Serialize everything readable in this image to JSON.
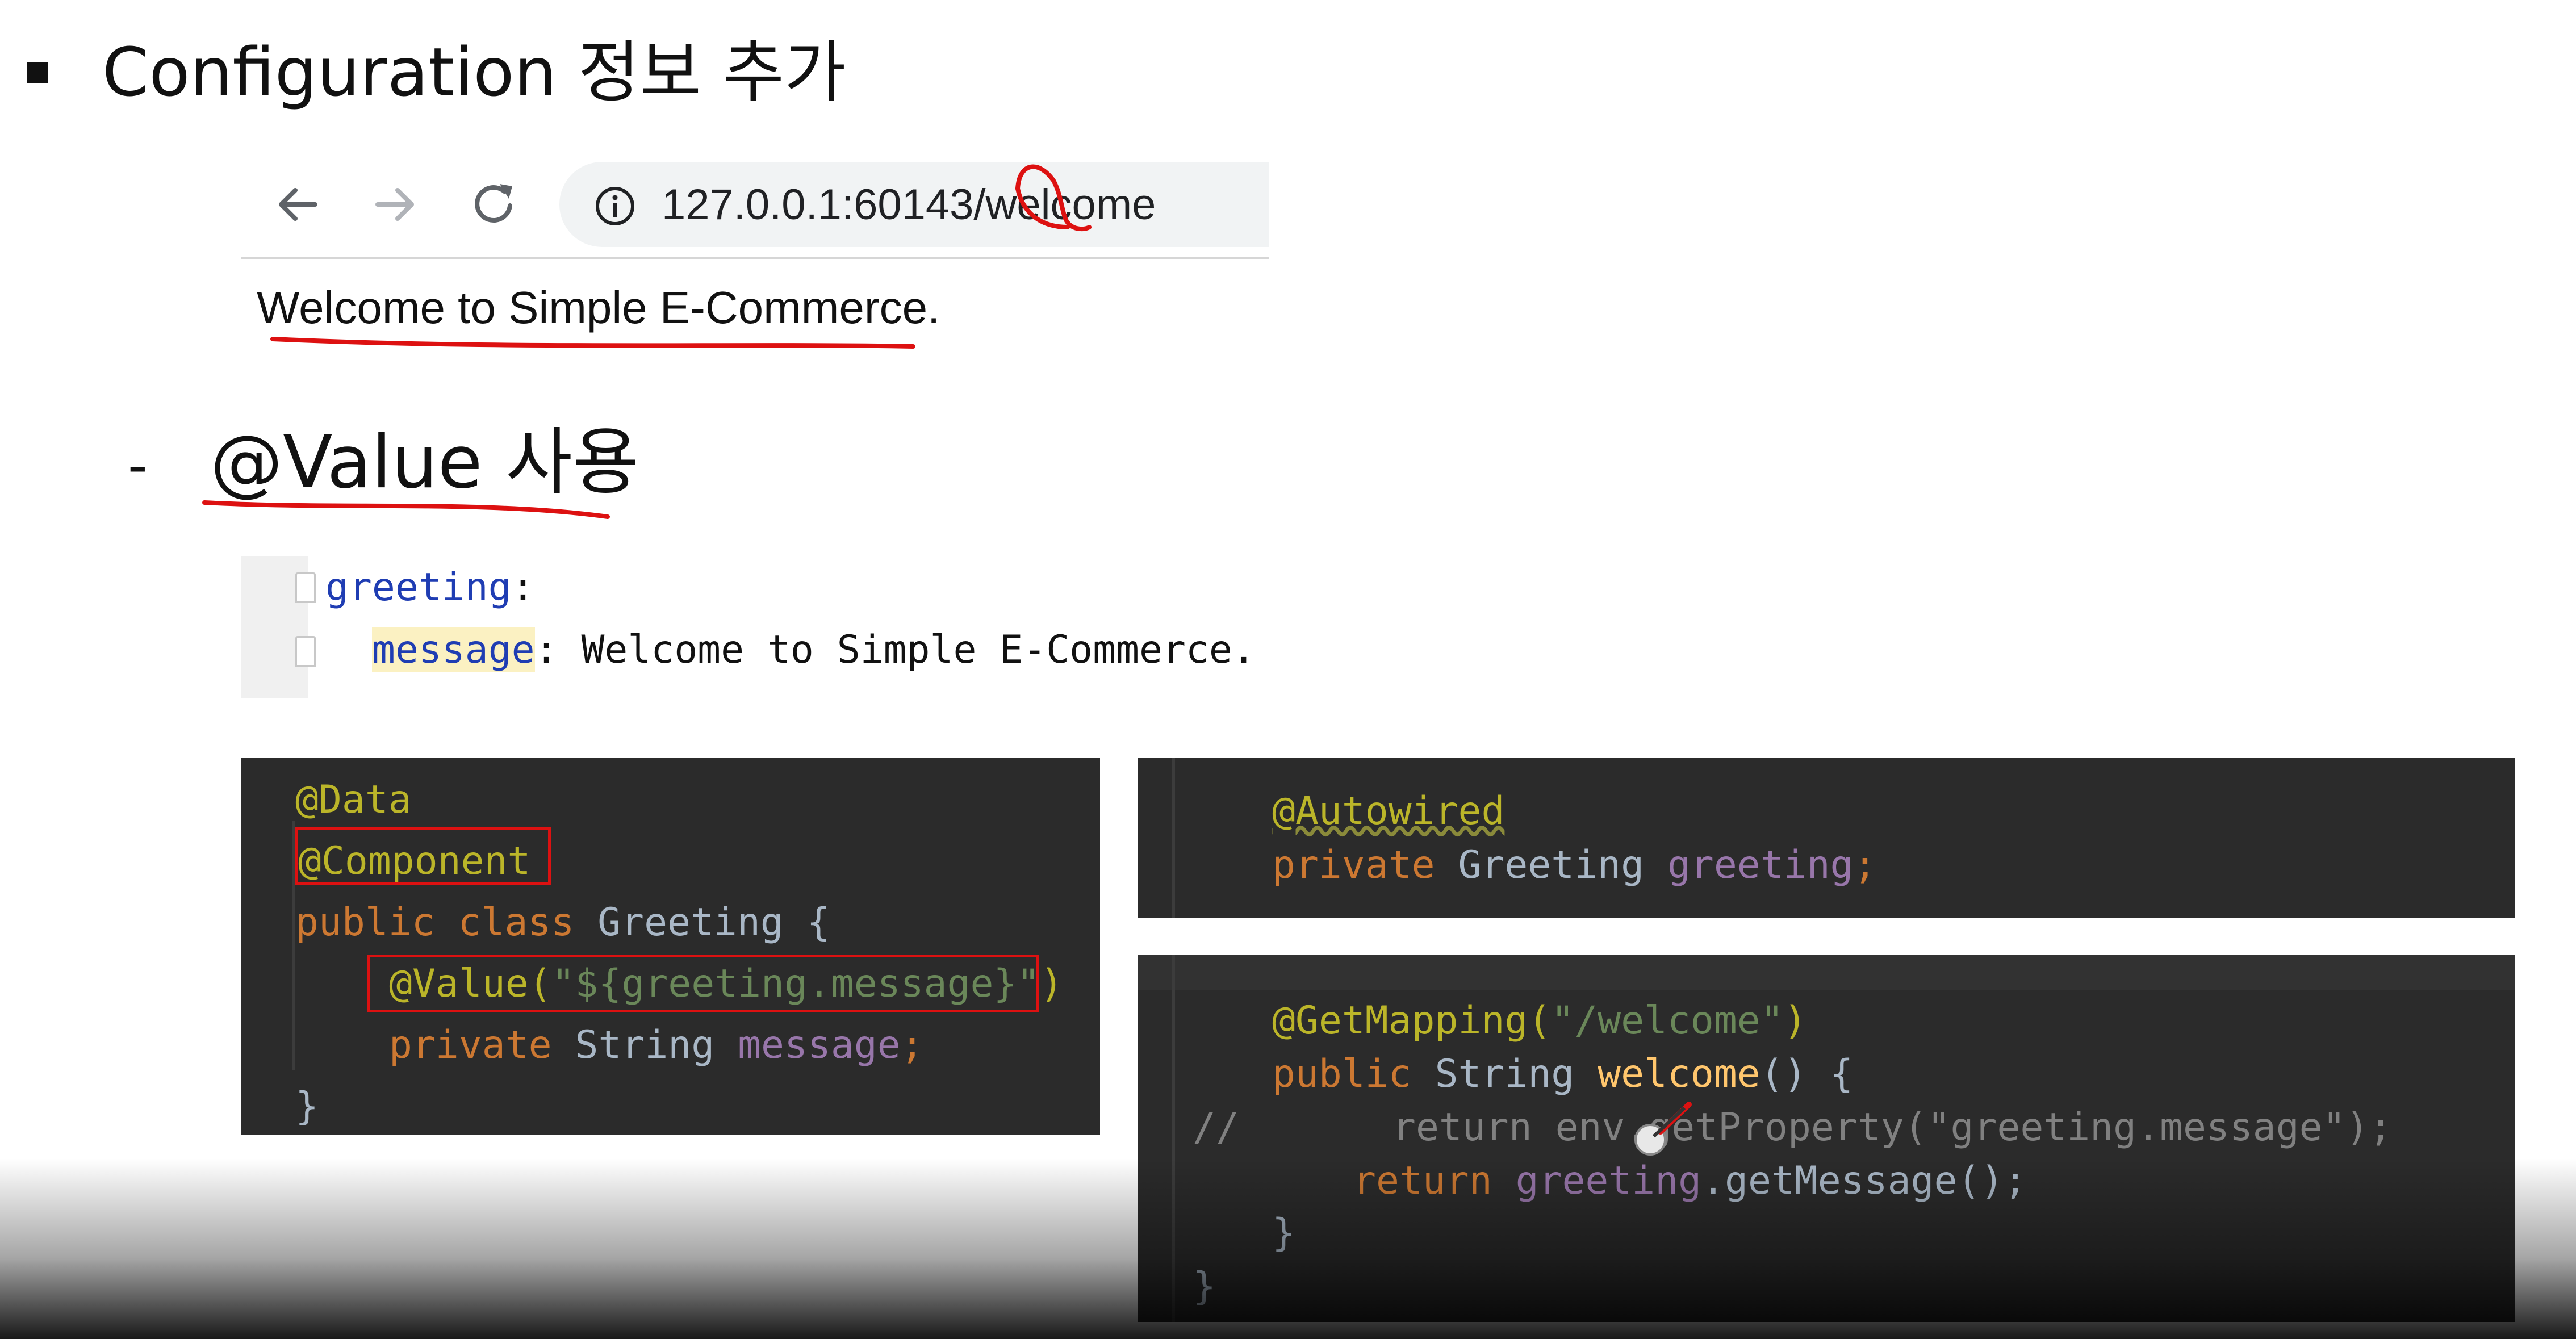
{
  "slide": {
    "heading": "Configuration 정보 추가",
    "subheading": "@Value 사용",
    "dash": "-"
  },
  "browser": {
    "url": "127.0.0.1:60143/welcome",
    "page_text": "Welcome to Simple E-Commerce."
  },
  "yaml": {
    "key1": "greeting",
    "colon1": ":",
    "key2": "message",
    "value2": ": Welcome to Simple E-Commerce."
  },
  "greeting_class": {
    "l1": "@Data",
    "l2": "@Component",
    "l3_kw": "public class",
    "l3_name": " Greeting {",
    "l4_ann": "@Value(",
    "l4_str": "\"${greeting.message}\"",
    "l4_end": ")",
    "l5_kw": "private",
    "l5_type": " String ",
    "l5_field": "message",
    "l5_semi": ";",
    "l6": "}"
  },
  "autowired_panel": {
    "l1": "@Autowired",
    "l2_kw": "private",
    "l2_type": " Greeting ",
    "l2_field": "greeting",
    "l2_semi": ";"
  },
  "controller_panel": {
    "l1_ann": "@GetMapping(",
    "l1_str": "\"/welcome\"",
    "l1_end": ")",
    "l2_kw": "public",
    "l2_type": " String ",
    "l2_fn": "welcome",
    "l2_end": "() {",
    "l3_comment_mark": "//",
    "l3_code": "return env.getProperty(\"greeting.message\");",
    "l4_kw": "return ",
    "l4_field": "greeting",
    "l4_call": ".getMessage();",
    "l5": "}",
    "l6": "}"
  },
  "colors": {
    "annotation_red": "#dd1111",
    "code_bg": "#2b2b2b"
  }
}
